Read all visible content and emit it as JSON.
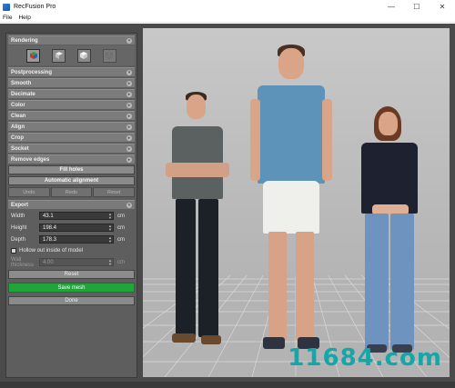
{
  "window": {
    "title": "RecFusion Pro",
    "controls": {
      "minimize": "—",
      "maximize": "☐",
      "close": "✕"
    }
  },
  "menu": [
    "File",
    "Help"
  ],
  "rendering": {
    "header": "Rendering",
    "modes": [
      {
        "icon": "color-cube-icon",
        "active": true
      },
      {
        "icon": "shaded-cube-icon",
        "active": false
      },
      {
        "icon": "solid-cube-icon",
        "active": false
      },
      {
        "icon": "wireframe-cube-icon",
        "active": false
      }
    ]
  },
  "postprocessing": {
    "header": "Postprocessing",
    "steps": [
      "Smooth",
      "Decimate",
      "Color",
      "Clean",
      "Align",
      "Crop",
      "Socket",
      "Remove edges"
    ],
    "fill_holes": "Fill holes",
    "automatic_alignment": "Automatic alignment",
    "undo": "Undo",
    "redo": "Redo",
    "reset": "Reset"
  },
  "export": {
    "header": "Export",
    "fields": [
      {
        "label": "Width",
        "value": "43.1",
        "unit": "cm"
      },
      {
        "label": "Height",
        "value": "198.4",
        "unit": "cm"
      },
      {
        "label": "Depth",
        "value": "178.3",
        "unit": "cm"
      }
    ],
    "hollow_label": "Hollow out inside of model",
    "wall_thickness": {
      "label": "Wall thickness",
      "value": "4.00",
      "unit": "cm"
    },
    "reset": "Reset",
    "save_mesh": "Save mesh",
    "done": "Done"
  },
  "watermark": "11684.com",
  "colors": {
    "save_button": "#1fa53a",
    "panel_bg": "#5e5e5e",
    "viewport_bg": "#bcbcbc"
  }
}
